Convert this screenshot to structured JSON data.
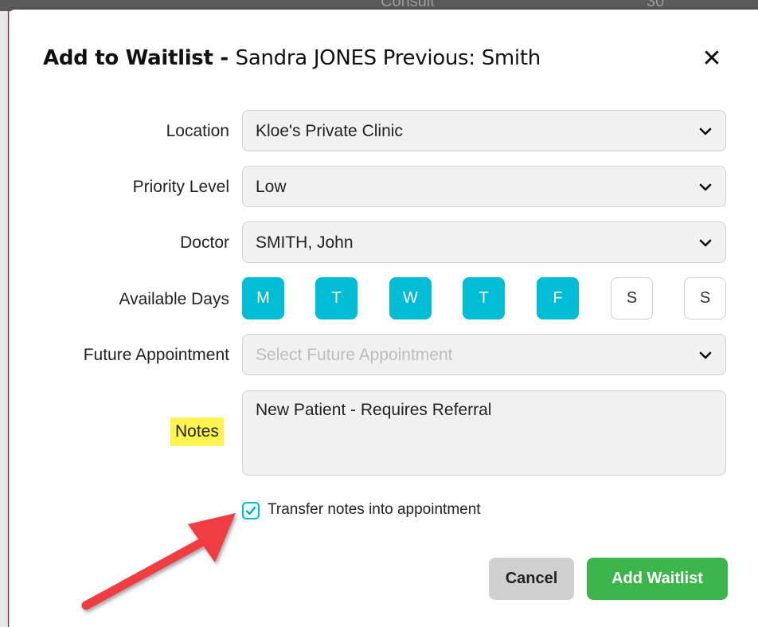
{
  "background": {
    "partial_text": "Consult",
    "partial_text_right": "30"
  },
  "dialog": {
    "title_prefix": "Add to Waitlist - ",
    "title_patient": "Sandra JONES Previous: Smith",
    "close_glyph": "✕"
  },
  "form": {
    "location": {
      "label": "Location",
      "value": "Kloe's Private Clinic"
    },
    "priority": {
      "label": "Priority Level",
      "value": "Low"
    },
    "doctor": {
      "label": "Doctor",
      "value": "SMITH, John"
    },
    "days": {
      "label": "Available Days",
      "items": [
        {
          "letter": "M",
          "selected": true
        },
        {
          "letter": "T",
          "selected": true
        },
        {
          "letter": "W",
          "selected": true
        },
        {
          "letter": "T",
          "selected": true
        },
        {
          "letter": "F",
          "selected": true
        },
        {
          "letter": "S",
          "selected": false
        },
        {
          "letter": "S",
          "selected": false
        }
      ]
    },
    "future_appointment": {
      "label": "Future Appointment",
      "placeholder": "Select Future Appointment"
    },
    "notes": {
      "label": "Notes",
      "value": "New Patient - Requires Referral"
    },
    "transfer_notes": {
      "label": "Transfer notes into appointment",
      "checked": true
    }
  },
  "buttons": {
    "cancel": "Cancel",
    "add": "Add Waitlist"
  },
  "colors": {
    "accent": "#00bcd4",
    "primary_button": "#3cb54a",
    "secondary_button": "#d0d0d0",
    "highlight": "#fff44f",
    "annotation_arrow": "#ef3e42"
  }
}
